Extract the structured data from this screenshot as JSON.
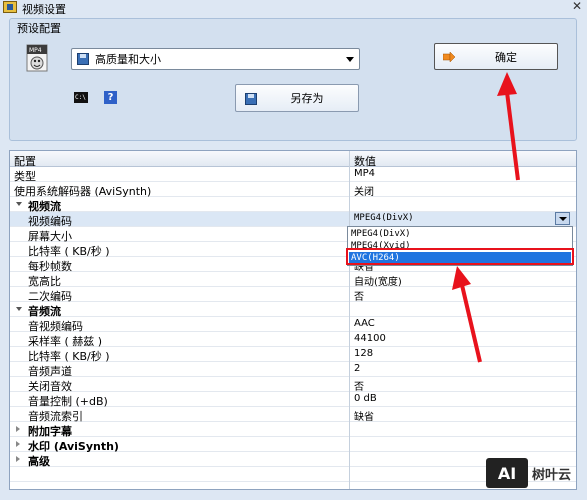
{
  "window": {
    "title": "视频设置",
    "close_glyph": "✕"
  },
  "preset": {
    "group_title": "预设配置",
    "selected": "高质量和大小",
    "icon": "mp4-file-icon",
    "icon_label": "MP4"
  },
  "buttons": {
    "ok_label": "确定",
    "save_as_label": "另存为"
  },
  "icons": {
    "cmd_label": "C:\\",
    "help_label": "?"
  },
  "grid": {
    "headers": [
      "配置",
      "数值"
    ],
    "rows": [
      {
        "name": "类型",
        "value": "MP4"
      },
      {
        "name": "使用系统解码器 (AviSynth)",
        "value": "关闭"
      },
      {
        "name": "视频流",
        "value": ""
      },
      {
        "name": "视频编码",
        "value": "MPEG4(DivX)"
      },
      {
        "name": "屏幕大小",
        "value": ""
      },
      {
        "name": "比特率 ( KB/秒 )",
        "value": ""
      },
      {
        "name": "每秒帧数",
        "value": "缺省"
      },
      {
        "name": "宽高比",
        "value": "自动(宽度)"
      },
      {
        "name": "二次编码",
        "value": "否"
      },
      {
        "name": "音频流",
        "value": ""
      },
      {
        "name": "音视频编码",
        "value": "AAC"
      },
      {
        "name": "采样率 ( 赫兹 )",
        "value": "44100"
      },
      {
        "name": "比特率 ( KB/秒 )",
        "value": "128"
      },
      {
        "name": "音频声道",
        "value": "2"
      },
      {
        "name": "关闭音效",
        "value": "否"
      },
      {
        "name": "音量控制 (+dB)",
        "value": "0 dB"
      },
      {
        "name": "音频流索引",
        "value": "缺省"
      },
      {
        "name": "附加字幕",
        "value": ""
      },
      {
        "name": "水印 (AviSynth)",
        "value": ""
      },
      {
        "name": "高级",
        "value": ""
      }
    ],
    "codec_options": [
      "MPEG4(DivX)",
      "MPEG4(Xvid)",
      "AVC(H264)"
    ],
    "codec_selected": "AVC(H264)"
  },
  "watermark": {
    "logo": "AI",
    "text": "树叶云"
  },
  "colors": {
    "arrow_red": "#e8121c",
    "dropdown_selected": "#1f74e0"
  }
}
